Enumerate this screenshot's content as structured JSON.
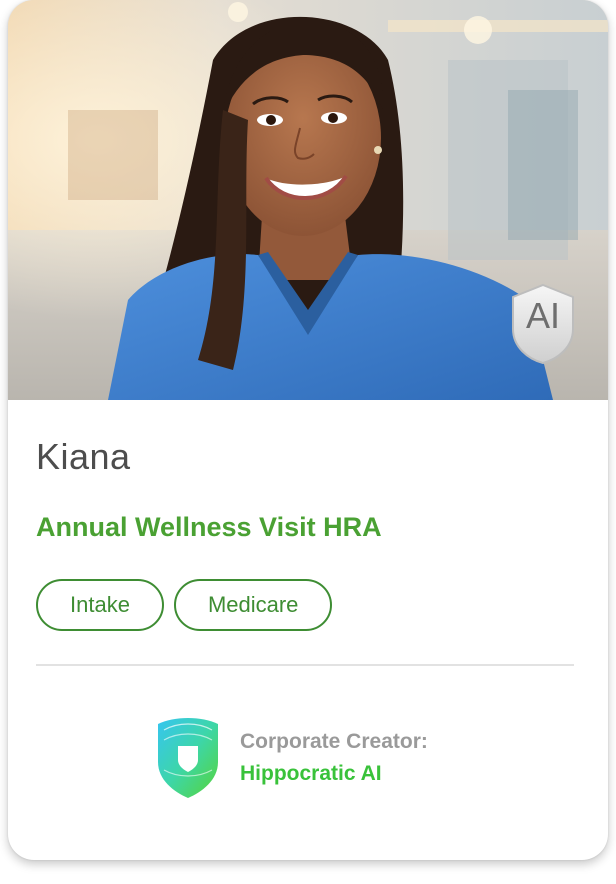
{
  "agent": {
    "photo_icon": "nurse-portrait-photo",
    "ai_badge": "AI",
    "name": "Kiana",
    "program": "Annual Wellness Visit HRA",
    "tags": [
      "Intake",
      "Medicare"
    ]
  },
  "creator": {
    "label": "Corporate Creator:",
    "name": "Hippocratic AI",
    "logo_icon": "hippocratic-shield-logo"
  },
  "colors": {
    "program_green": "#4aa133",
    "tag_green": "#3e8d33",
    "creator_green": "#39c23a",
    "scrubs_blue": "#3f7fcf"
  }
}
